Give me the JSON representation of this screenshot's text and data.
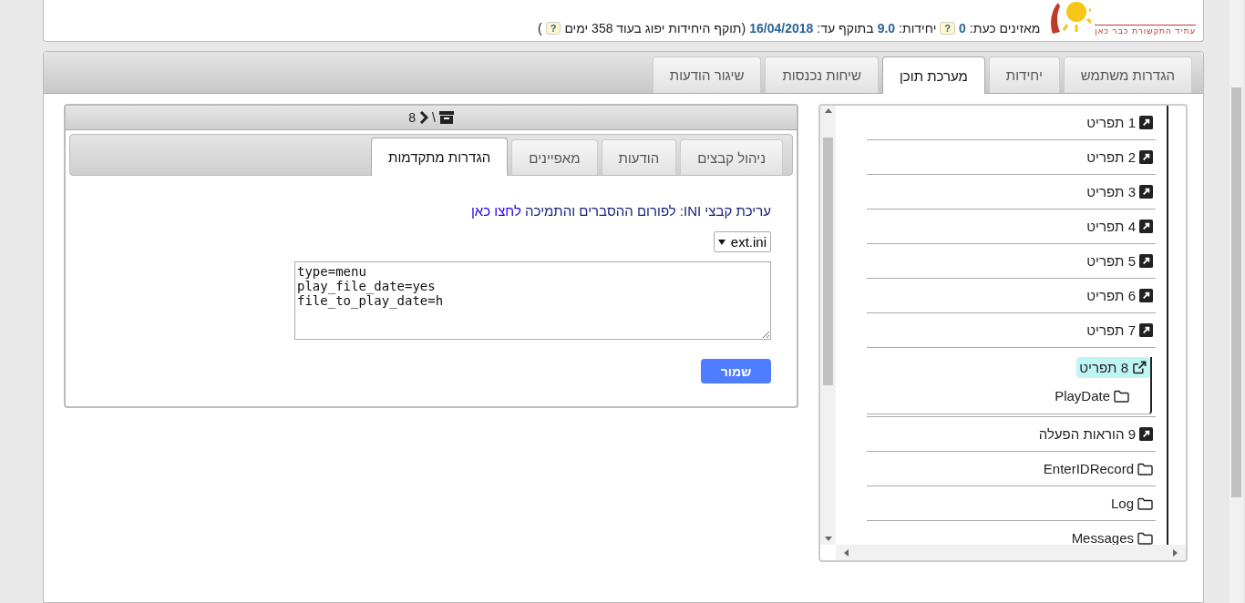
{
  "header": {
    "logo_tagline": "עתיד התקשורת כבר כאן",
    "listeners_label": "מאזינים כעת:",
    "listeners": "0",
    "help_1": "?",
    "units_label": "יחידות:",
    "units": "9.0",
    "valid_label": "בתוקף עד:",
    "valid_until": "16/04/2018",
    "expiry_note": "(תוקף היחידות יפוג בעוד 358 ימים",
    "help_2": "?",
    "expiry_close": ")"
  },
  "tabs": [
    {
      "label": "הגדרות משתמש",
      "selected": false
    },
    {
      "label": "יחידות",
      "selected": false
    },
    {
      "label": "מערכת תוכן",
      "selected": true
    },
    {
      "label": "שיחות נכנסות",
      "selected": false
    },
    {
      "label": "שיגור הודעות",
      "selected": false
    }
  ],
  "tree": [
    {
      "label": "1 תפריט",
      "kind": "link",
      "selected": false
    },
    {
      "label": "2 תפריט",
      "kind": "link",
      "selected": false
    },
    {
      "label": "3 תפריט",
      "kind": "link",
      "selected": false
    },
    {
      "label": "4 תפריט",
      "kind": "link",
      "selected": false
    },
    {
      "label": "5 תפריט",
      "kind": "link",
      "selected": false
    },
    {
      "label": "6 תפריט",
      "kind": "link",
      "selected": false
    },
    {
      "label": "7 תפריט",
      "kind": "link",
      "selected": false
    },
    {
      "label": "8 תפריט",
      "kind": "link",
      "selected": true,
      "children": [
        {
          "label": "PlayDate",
          "kind": "folder",
          "selected": false
        }
      ]
    },
    {
      "label": "9 הוראות הפעלה",
      "kind": "link",
      "selected": false
    },
    {
      "label": "EnterIDRecord",
      "kind": "folder",
      "selected": false
    },
    {
      "label": "Log",
      "kind": "folder",
      "selected": false
    },
    {
      "label": "Messages",
      "kind": "folder",
      "selected": false
    }
  ],
  "editor": {
    "breadcrumb_separator": "\\",
    "breadcrumb_current": "8",
    "tabs": [
      {
        "label": "ניהול קבצים",
        "selected": false
      },
      {
        "label": "הודעות",
        "selected": false
      },
      {
        "label": "מאפיינים",
        "selected": false
      },
      {
        "label": "הגדרות מתקדמות",
        "selected": true
      }
    ],
    "intro": "עריכת קבצי INI: לפורום ההסברים והתמיכה",
    "link": "לחצו כאן",
    "file_select": "ext.ini",
    "content": "type=menu\nplay_file_date=yes\nfile_to_play_date=h",
    "save_button": "שמור"
  }
}
